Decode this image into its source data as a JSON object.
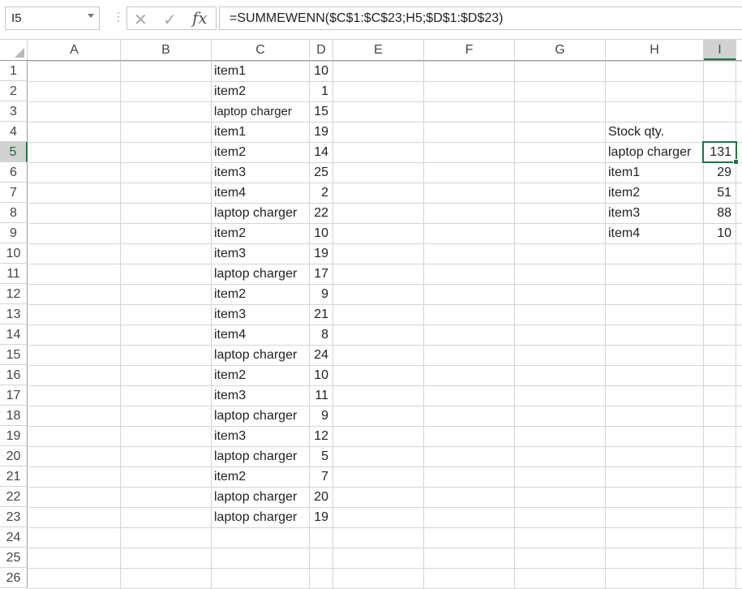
{
  "name_box": "I5",
  "formula": "=SUMMEWENN($C$1:$C$23;H5;$D$1:$D$23)",
  "fx_label": "fx",
  "columns": [
    "A",
    "B",
    "C",
    "D",
    "E",
    "F",
    "G",
    "H",
    "I"
  ],
  "selected_column": "I",
  "rows": [
    "1",
    "2",
    "3",
    "4",
    "5",
    "6",
    "7",
    "8",
    "9",
    "10",
    "11",
    "12",
    "13",
    "14",
    "15",
    "16",
    "17",
    "18",
    "19",
    "20",
    "21",
    "22",
    "23",
    "24",
    "25",
    "26"
  ],
  "selected_row": "5",
  "col_c": [
    "item1",
    "item2",
    "laptop charger",
    "item1",
    "item2",
    "item3",
    "item4",
    "laptop charger",
    "item2",
    "item3",
    "laptop charger",
    "item2",
    "item3",
    "item4",
    "laptop charger",
    "item2",
    "item3",
    "laptop charger",
    "item3",
    "laptop charger",
    "item2",
    "laptop charger",
    "laptop charger"
  ],
  "col_d": [
    "10",
    "1",
    "15",
    "19",
    "14",
    "25",
    "2",
    "22",
    "10",
    "19",
    "17",
    "9",
    "21",
    "8",
    "24",
    "10",
    "11",
    "9",
    "12",
    "5",
    "7",
    "20",
    "19"
  ],
  "summary_header": "Stock qty.",
  "summary_labels": [
    "laptop charger",
    "item1",
    "item2",
    "item3",
    "item4"
  ],
  "summary_values": [
    "131",
    "29",
    "51",
    "88",
    "10"
  ],
  "colors": {
    "accent": "#217346",
    "gridline": "#d4d4d4"
  }
}
